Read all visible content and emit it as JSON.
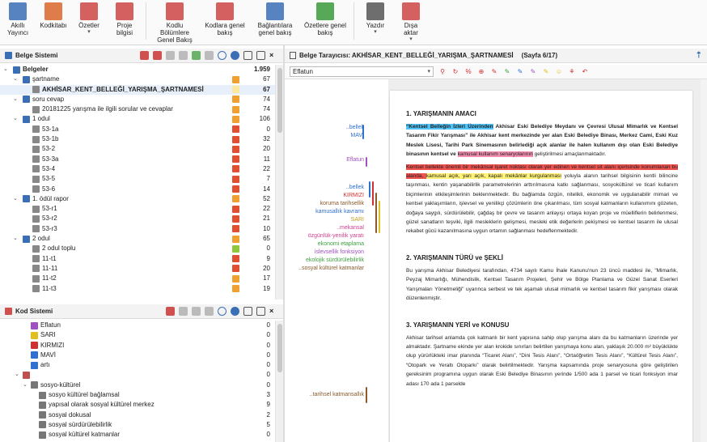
{
  "ribbon": {
    "buttons": [
      {
        "label": "Akıllı\nYayıncı",
        "arrow": "",
        "color": "#3a6fb5",
        "icon": "book-icon"
      },
      {
        "label": "Kodkitabı",
        "arrow": "",
        "color": "#d9662a",
        "icon": "codebook-icon"
      },
      {
        "label": "Özetler",
        "arrow": "▾",
        "color": "#c44",
        "icon": "summary-icon"
      },
      {
        "label": "Proje\nbilgisi",
        "arrow": "",
        "color": "#c44",
        "icon": "project-info-icon"
      },
      {
        "label": "Kodlu Bölümlere\nGenel Bakış",
        "arrow": "",
        "color": "#c44",
        "icon": "coded-segments-icon"
      },
      {
        "label": "Kodlara genel\nbakış",
        "arrow": "",
        "color": "#c44",
        "icon": "codes-overview-icon"
      },
      {
        "label": "Bağlantılara\ngenel bakış",
        "arrow": "",
        "color": "#3a6fb5",
        "icon": "links-overview-icon"
      },
      {
        "label": "Özetlere genel\nbakış",
        "arrow": "",
        "color": "#3a9a3a",
        "icon": "summaries-overview-icon"
      },
      {
        "label": "Yazdır",
        "arrow": "▾",
        "color": "#555",
        "icon": "printer-icon"
      },
      {
        "label": "Dışa\naktar",
        "arrow": "▾",
        "color": "#c44",
        "icon": "export-icon"
      }
    ]
  },
  "doc_system": {
    "title": "Belge Sistemi",
    "rows": [
      {
        "exp": "⌄",
        "indent": 0,
        "label": "Belgeler",
        "count": "1.959",
        "icon_color": "#3a6fb5",
        "bold": true,
        "tag": ""
      },
      {
        "exp": "⌄",
        "indent": 1,
        "label": "şartname",
        "count": "67",
        "icon_color": "#3a6fb5",
        "bold": false,
        "tag": "#f0a030"
      },
      {
        "exp": "",
        "indent": 2,
        "label": "AKHİSAR_KENT_BELLEĞİ_YARIŞMA_ŞARTNAMESİ",
        "count": "67",
        "icon_color": "#888",
        "bold": true,
        "tag": "#fce9a0",
        "sel": true
      },
      {
        "exp": "⌄",
        "indent": 1,
        "label": "soru cevap",
        "count": "74",
        "icon_color": "#3a6fb5",
        "bold": false,
        "tag": "#f0a030"
      },
      {
        "exp": "",
        "indent": 2,
        "label": "20181225 yarışma ile ilgili sorular ve cevaplar",
        "count": "74",
        "icon_color": "#888",
        "bold": false,
        "tag": "#f0a030"
      },
      {
        "exp": "⌄",
        "indent": 1,
        "label": "1 odul",
        "count": "106",
        "icon_color": "#3a6fb5",
        "bold": false,
        "tag": "#f0a030"
      },
      {
        "exp": "",
        "indent": 2,
        "label": "53-1a",
        "count": "0",
        "icon_color": "#888",
        "bold": false,
        "tag": "#e05030"
      },
      {
        "exp": "",
        "indent": 2,
        "label": "53-1b",
        "count": "32",
        "icon_color": "#888",
        "bold": false,
        "tag": "#e05030"
      },
      {
        "exp": "",
        "indent": 2,
        "label": "53-2",
        "count": "20",
        "icon_color": "#888",
        "bold": false,
        "tag": "#e05030"
      },
      {
        "exp": "",
        "indent": 2,
        "label": "53-3a",
        "count": "11",
        "icon_color": "#888",
        "bold": false,
        "tag": "#e05030"
      },
      {
        "exp": "",
        "indent": 2,
        "label": "53-4",
        "count": "22",
        "icon_color": "#888",
        "bold": false,
        "tag": "#e05030"
      },
      {
        "exp": "",
        "indent": 2,
        "label": "53-5",
        "count": "7",
        "icon_color": "#888",
        "bold": false,
        "tag": "#e05030"
      },
      {
        "exp": "",
        "indent": 2,
        "label": "53-6",
        "count": "14",
        "icon_color": "#888",
        "bold": false,
        "tag": "#e05030"
      },
      {
        "exp": "⌄",
        "indent": 1,
        "label": "1. ödül rapor",
        "count": "52",
        "icon_color": "#3a6fb5",
        "bold": false,
        "tag": "#f0a030"
      },
      {
        "exp": "",
        "indent": 2,
        "label": "53-r1",
        "count": "22",
        "icon_color": "#888",
        "bold": false,
        "tag": "#e05030"
      },
      {
        "exp": "",
        "indent": 2,
        "label": "53-r2",
        "count": "21",
        "icon_color": "#888",
        "bold": false,
        "tag": "#e05030"
      },
      {
        "exp": "",
        "indent": 2,
        "label": "53-r3",
        "count": "10",
        "icon_color": "#888",
        "bold": false,
        "tag": "#e05030"
      },
      {
        "exp": "⌄",
        "indent": 1,
        "label": "2 odul",
        "count": "65",
        "icon_color": "#3a6fb5",
        "bold": false,
        "tag": "#f0a030"
      },
      {
        "exp": "",
        "indent": 2,
        "label": "2 odul toplu",
        "count": "0",
        "icon_color": "#888",
        "bold": false,
        "tag": "#8fc73e"
      },
      {
        "exp": "",
        "indent": 2,
        "label": "11-t1",
        "count": "9",
        "icon_color": "#888",
        "bold": false,
        "tag": "#e05030"
      },
      {
        "exp": "",
        "indent": 2,
        "label": "11-11",
        "count": "20",
        "icon_color": "#888",
        "bold": false,
        "tag": "#e05030"
      },
      {
        "exp": "",
        "indent": 2,
        "label": "11-t2",
        "count": "17",
        "icon_color": "#888",
        "bold": false,
        "tag": "#f0a030"
      },
      {
        "exp": "",
        "indent": 2,
        "label": "11-t3",
        "count": "19",
        "icon_color": "#888",
        "bold": false,
        "tag": "#f0a030"
      }
    ]
  },
  "code_system": {
    "title": "Kod Sistemi",
    "rows": [
      {
        "exp": "",
        "indent": 1,
        "label": "Eflatun",
        "count": "0",
        "icon_color": "#a050c0"
      },
      {
        "exp": "",
        "indent": 1,
        "label": "SARI",
        "count": "0",
        "icon_color": "#e0c020"
      },
      {
        "exp": "",
        "indent": 1,
        "label": "KIRMIZI",
        "count": "0",
        "icon_color": "#d03030"
      },
      {
        "exp": "",
        "indent": 1,
        "label": "MAVİ",
        "count": "0",
        "icon_color": "#3070d0"
      },
      {
        "exp": "",
        "indent": 1,
        "label": "artı",
        "count": "0",
        "icon_color": "#3070d0"
      },
      {
        "exp": "⌄",
        "indent": 0,
        "label": "",
        "count": "0",
        "icon_color": "#c05050"
      },
      {
        "exp": "⌄",
        "indent": 1,
        "label": "sosyo-kültürel",
        "count": "0",
        "icon_color": "#777"
      },
      {
        "exp": "",
        "indent": 2,
        "label": "sosyo kültürel bağlamsal",
        "count": "3",
        "icon_color": "#777"
      },
      {
        "exp": "",
        "indent": 2,
        "label": "yapısal olarak sosyal kültürel merkez",
        "count": "9",
        "icon_color": "#777"
      },
      {
        "exp": "",
        "indent": 2,
        "label": "sosyal dokusal",
        "count": "2",
        "icon_color": "#777"
      },
      {
        "exp": "",
        "indent": 2,
        "label": "sosyal sürdürülebilirlik",
        "count": "5",
        "icon_color": "#777"
      },
      {
        "exp": "",
        "indent": 2,
        "label": "sosyal kültürel katmanlar",
        "count": "0",
        "icon_color": "#777"
      }
    ]
  },
  "browser": {
    "title": "Belge Tarayıcısı: AKHİSAR_KENT_BELLEĞİ_YARIŞMA_ŞARTNAMESİ",
    "page_info": "(Sayfa 6/17)",
    "code_select": "Eflatun"
  },
  "margin_labels": [
    {
      "text": "..bellek",
      "color": "#3070d0"
    },
    {
      "text": "MAVİ",
      "color": "#3070d0"
    },
    {
      "text": "Eflatun",
      "color": "#a050c0"
    },
    {
      "text": "..bellek",
      "color": "#3070d0"
    },
    {
      "text": "KIRMIZI",
      "color": "#d03030"
    },
    {
      "text": "koruma tarihsellik",
      "color": "#8a5a2a"
    },
    {
      "text": "kamusallık kavramı",
      "color": "#3070d0"
    },
    {
      "text": "SARI",
      "color": "#c0a020"
    },
    {
      "text": "..mekansal",
      "color": "#d04090"
    },
    {
      "text": "özgünlük-yenilik yaratı",
      "color": "#d04090"
    },
    {
      "text": "ekonomi etaplama",
      "color": "#40a040"
    },
    {
      "text": "islevsellik fonksiyon",
      "color": "#a050c0"
    },
    {
      "text": "ekolojik sürdürülebilirlik",
      "color": "#40a040"
    },
    {
      "text": "..sosyal kültürel katmanlar",
      "color": "#8a5a2a"
    },
    {
      "text": "..tarihsel katmansallık",
      "color": "#8a5a2a"
    }
  ],
  "document": {
    "s1_title": "1. YARIŞMANIN AMACI",
    "s1_p1_a": "“Kentsel Belleğin İzleri Üzerinden",
    "s1_p1_b": " Akhisar Eski Belediye Meydanı ve Çevresi Ulusal Mimarlık ve Kentsel Tasarım Fikir Yarışması” ile Akhisar kent merkezinde yer alan Eski Belediye Binası, Merkez Cami, Eski Kuz Meslek Lisesi, Tarihi Park Sinemasının belirlediği açık alanlar ile halen kullanım dışı olan Eski Belediye binasının kentsel ve ",
    "s1_p1_c": "kamusal kullanım senaryolarının",
    "s1_p1_d": " geliştirilmesi amaçlanmaktadır.",
    "s1_p2_a": "Kentsel bellekte önemli bir mekânsal işaret noktası olarak yer edinen ve kentsel sit alanı içerisinde konumlanan bu alanda, ",
    "s1_p2_b": "kamusal açık, yarı açık, kapalı mekânlar kurgulanması",
    "s1_p2_c": " yoluyla alanın tarihsel bilgisinin kentli bilincine taşınması, kentin yaşanabilirlik parametrelerinin arttırılmasına katkı sağlanması, sosyokültürel ve ticari kullanım biçimlerinin etkileşimlerinin beklenmektedir. Bu bağlamda özgün, nitelikli, ekonomik ve uygulanabilir mimari ve kentsel yaklaşımların, işlevsel ve yenilikçi çözümlerin öne çıkarılması, tüm sosyal katmanların kullanımını gözeten, doğaya saygılı, sürdürülebilir, çağdaş bir çevre ve tasarım anlayışı ortaya koyan proje ve müelliflerin belirlenmesi, güzel sanatların teşviki, ilgili mesleklerin gelişmesi, mesleki etik değerlerin pekişmesi ve kentsel tasarım ile ulusal rekabet gücü kazanılmasına uygun ortamın sağlanması hedeflenmektedir.",
    "s2_title": "2. YARIŞMANIN TÜRÜ ve ŞEKLİ",
    "s2_p": "Bu yarışma Akhisar Belediyesi tarafından, 4734 sayılı Kamu İhale Kanunu'nun 23 üncü maddesi ile, \"Mimarlık, Peyzaj Mimarlığı, Mühendislik, Kentsel Tasarım Projeleri, Şehir ve Bölge Planlama ve Güzel Sanat Eserleri Yarışmaları Yönetmeliği\" uyarınca serbest ve tek aşamalı ulusal mimarlık ve kentsel tasarım fikir yarışması olarak düzenlenmiştir.",
    "s3_title": "3. YARIŞMANIN YERİ ve KONUSU",
    "s3_p": "Akhisar tarihsel anlamda çok katmanlı bir kent yapısına sahip olup yarışma alanı da bu katmanların üzerinde yer almaktadır. Şartname ekinde yer alan krokide sınırları belirtilen yarışmaya konu alan, yaklaşık 20.000 m² büyüklükte olup yürürlükteki imar planında “Ticaret Alanı”, “Dini Tesis Alanı”, “Ortaöğretim Tesis Alanı”, “Kültürel Tesis Alanı”, “Otopark ve Yeraltı Otoparkı” olarak belirtilmektedir. Yarışma kapsamında proje senaryosuna göre geliştirilen gereksinim programına uygun olarak Eski Belediye Binasının yerinde 1/500 ada 1 parsel ve ticari fonksiyon imar adası 170 ada 1 parselde"
  }
}
